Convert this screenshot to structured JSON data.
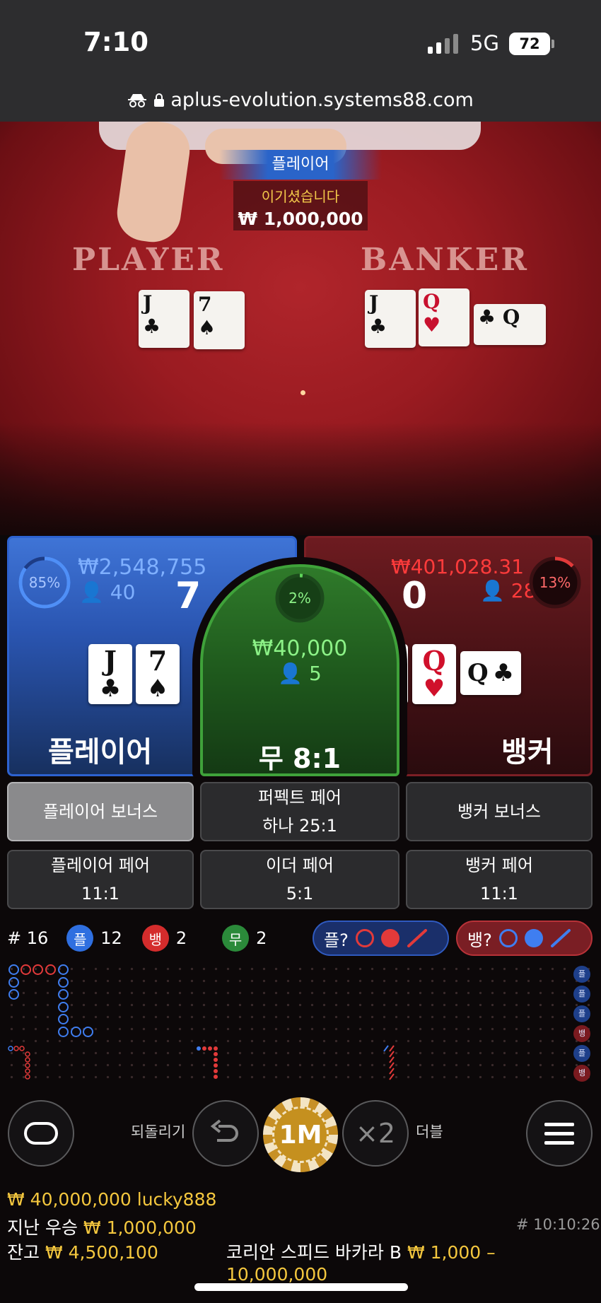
{
  "status_bar": {
    "time": "7:10",
    "network": "5G",
    "battery": "72"
  },
  "url_bar": {
    "url": "aplus-evolution.systems88.com"
  },
  "video": {
    "win_side": "플레이어",
    "win_text": "이기셨습니다",
    "win_amount": "₩ 1,000,000",
    "player_label": "PLAYER",
    "banker_label": "BANKER",
    "player_cards": [
      {
        "rank": "J",
        "suit": "♣"
      },
      {
        "rank": "7",
        "suit": "♠"
      }
    ],
    "banker_cards": [
      {
        "rank": "J",
        "suit": "♣"
      },
      {
        "rank": "Q",
        "suit": "♥"
      },
      {
        "rank": "Q",
        "suit": "♣"
      }
    ]
  },
  "player_panel": {
    "percent": "85%",
    "percent_value": 0.85,
    "amount": "₩2,548,755",
    "bettors": "40",
    "score": "7",
    "name": "플레이어",
    "cards": [
      {
        "rank": "J",
        "suit": "♣"
      },
      {
        "rank": "7",
        "suit": "♠"
      }
    ]
  },
  "tie_panel": {
    "percent": "2%",
    "percent_value": 0.02,
    "amount": "₩40,000",
    "bettors": "5",
    "name": "무 8:1"
  },
  "banker_panel": {
    "percent": "13%",
    "percent_value": 0.13,
    "amount": "₩401,028.31",
    "bettors": "28",
    "score": "0",
    "name": "뱅커",
    "cards": [
      {
        "rank": "J",
        "suit": "♣"
      },
      {
        "rank": "Q",
        "suit": "♥"
      },
      {
        "rank": "Q",
        "suit": "♣"
      }
    ]
  },
  "side_bets": {
    "player_bonus": "플레이어 보너스",
    "perfect_pair_line1": "퍼펙트 페어",
    "perfect_pair_line2": "하나 25:1",
    "banker_bonus": "뱅커 보너스",
    "player_pair_line1": "플레이어 페어",
    "player_pair_line2": "11:1",
    "either_pair_line1": "이더 페어",
    "either_pair_line2": "5:1",
    "banker_pair_line1": "뱅커 페어",
    "banker_pair_line2": "11:1"
  },
  "stats": {
    "round": "# 16",
    "player_badge": "플",
    "player_count": "12",
    "banker_badge": "뱅",
    "banker_count": "2",
    "tie_badge": "무",
    "tie_count": "2",
    "player_predict": "플?",
    "banker_predict": "뱅?"
  },
  "road_side_labels": [
    "플",
    "플",
    "플",
    "뱅",
    "플",
    "뱅"
  ],
  "controls": {
    "undo_label": "되돌리기",
    "chip_value": "1M",
    "double_symbol": "×2",
    "double_label": "더블"
  },
  "footer": {
    "top_winner": "₩ 40,000,000 lucky888",
    "last_win_label": "지난 우승",
    "last_win_amount": "₩ 1,000,000",
    "round_time": "# 10:10:26",
    "balance_label": "잔고",
    "balance_amount": "₩ 4,500,100",
    "table_name": "코리안 스피드 바카라 B",
    "limits": "₩ 1,000 – 10,000,000"
  },
  "colors": {
    "player": "#2d62d0",
    "banker": "#b83238",
    "tie": "#3fa23a",
    "gold": "#f4c73e"
  }
}
